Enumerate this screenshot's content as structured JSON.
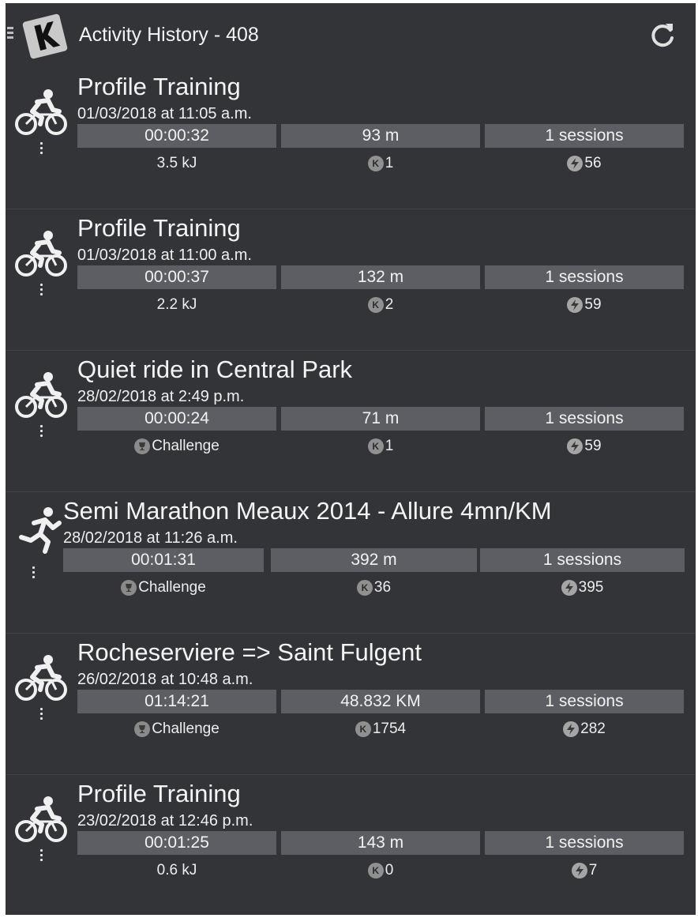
{
  "app": {
    "title": "Activity History - 408",
    "logo_letter": "K",
    "icons": {
      "menu": "menu-icon",
      "logo": "k-logo-icon",
      "refresh": "refresh-icon"
    }
  },
  "activities": [
    {
      "sport": "cycling",
      "title": "Profile Training",
      "date": "01/03/2018 at 11:05 a.m.",
      "duration": "00:00:32",
      "distance": "93 m",
      "sessions": "1 sessions",
      "energy": "3.5 kJ",
      "challenge": "",
      "k_points": "1",
      "bolt_points": "56"
    },
    {
      "sport": "cycling",
      "title": "Profile Training",
      "date": "01/03/2018 at 11:00 a.m.",
      "duration": "00:00:37",
      "distance": "132 m",
      "sessions": "1 sessions",
      "energy": "2.2 kJ",
      "challenge": "",
      "k_points": "2",
      "bolt_points": "59"
    },
    {
      "sport": "cycling",
      "title": "Quiet ride in Central Park",
      "date": "28/02/2018 at 2:49 p.m.",
      "duration": "00:00:24",
      "distance": "71 m",
      "sessions": "1 sessions",
      "energy": "",
      "challenge": "Challenge",
      "k_points": "1",
      "bolt_points": "59"
    },
    {
      "sport": "running",
      "title": "Semi Marathon Meaux 2014 - Allure 4mn/KM",
      "date": "28/02/2018 at 11:26 a.m.",
      "duration": "00:01:31",
      "distance": "392 m",
      "sessions": "1 sessions",
      "energy": "",
      "challenge": "Challenge",
      "k_points": "36",
      "bolt_points": "395"
    },
    {
      "sport": "cycling",
      "title": "Rocheserviere => Saint Fulgent",
      "date": "26/02/2018 at 10:48 a.m.",
      "duration": "01:14:21",
      "distance": "48.832 KM",
      "sessions": "1 sessions",
      "energy": "",
      "challenge": "Challenge",
      "k_points": "1754",
      "bolt_points": "282"
    },
    {
      "sport": "cycling",
      "title": "Profile Training",
      "date": "23/02/2018 at 12:46 p.m.",
      "duration": "00:01:25",
      "distance": "143 m",
      "sessions": "1 sessions",
      "energy": "0.6 kJ",
      "challenge": "",
      "k_points": "0",
      "bolt_points": "7"
    }
  ],
  "badges": {
    "k": "K"
  },
  "colors": {
    "background": "#333438",
    "stat_box": "#5d5e63",
    "text": "#f2f2f2"
  }
}
